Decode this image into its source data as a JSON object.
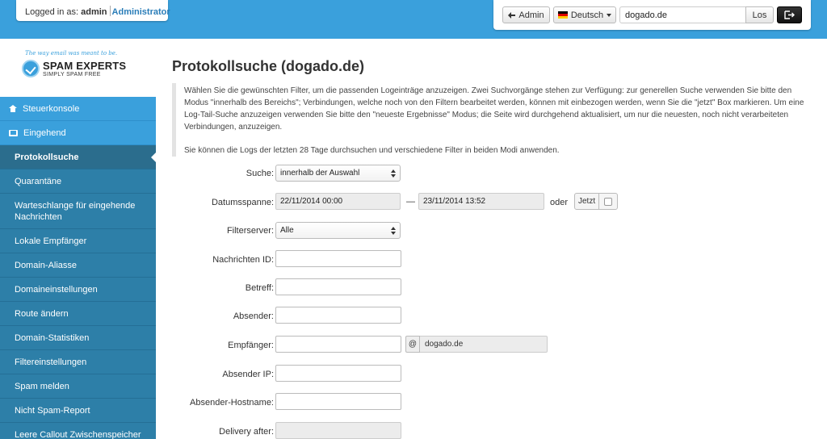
{
  "header": {
    "login_prefix": "Logged in as:",
    "username": "admin",
    "role": "Administrator",
    "admin_button": "Admin",
    "language": "Deutsch",
    "domain_value": "dogado.de",
    "go_button": "Los"
  },
  "logo": {
    "tagline": "The way email was meant to be.",
    "brand": "SPAM EXPERTS",
    "sub": "SIMPLY SPAM FREE"
  },
  "sidebar": {
    "top_items": [
      {
        "label": "Steuerkonsole"
      },
      {
        "label": "Eingehend"
      }
    ],
    "items": [
      {
        "label": "Protokollsuche",
        "active": true
      },
      {
        "label": "Quarantäne"
      },
      {
        "label": "Warteschlange für eingehende Nachrichten"
      },
      {
        "label": "Lokale Empfänger"
      },
      {
        "label": "Domain-Aliasse"
      },
      {
        "label": "Domaineinstellungen"
      },
      {
        "label": "Route ändern"
      },
      {
        "label": "Domain-Statistiken"
      },
      {
        "label": "Filtereinstellungen"
      },
      {
        "label": "Spam melden"
      },
      {
        "label": "Nicht Spam-Report"
      },
      {
        "label": "Leere Callout Zwischenspeicher"
      }
    ]
  },
  "main": {
    "title": "Protokollsuche (dogado.de)",
    "info_1": "Wählen Sie die gewünschten Filter, um die passenden Logeinträge anzuzeigen. Zwei Suchvorgänge stehen zur Verfügung: zur generellen Suche verwenden Sie bitte den Modus \"innerhalb des Bereichs\"; Verbindungen, welche noch von den Filtern bearbeitet werden, können mit einbezogen werden, wenn Sie die \"jetzt\" Box markieren. Um eine Log-Tail-Suche anzuzeigen verwenden Sie bitte den \"neueste Ergebnisse\" Modus; die Seite wird durchgehend aktualisiert, um nur die neuesten, noch nicht verarbeiteten Verbindungen, anzuzeigen.",
    "info_2": "Sie können die Logs der letzten 28 Tage durchsuchen und verschiedene Filter in beiden Modi anwenden.",
    "form": {
      "search_label": "Suche:",
      "search_value": "innerhalb der Auswahl",
      "date_label": "Datumsspanne:",
      "date_from": "22/11/2014 00:00",
      "date_dash": "—",
      "date_to": "23/11/2014 13:52",
      "or_label": "oder",
      "now_label": "Jetzt",
      "filterserver_label": "Filterserver:",
      "filterserver_value": "Alle",
      "message_id_label": "Nachrichten ID:",
      "subject_label": "Betreff:",
      "sender_label": "Absender:",
      "recipient_label": "Empfänger:",
      "recipient_at": "@",
      "recipient_domain": "dogado.de",
      "sender_ip_label": "Absender IP:",
      "sender_host_label": "Absender-Hostname:",
      "delivery_after_label": "Delivery after:"
    }
  }
}
